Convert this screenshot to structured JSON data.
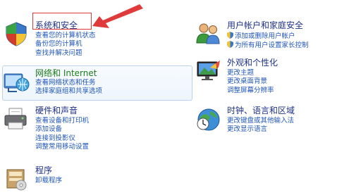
{
  "categories": {
    "system_security": {
      "title": "系统和安全",
      "links": [
        "查看您的计算机状态",
        "备份您的计算机",
        "查找并解决问题"
      ]
    },
    "network": {
      "title": "网络和 Internet",
      "links": [
        "查看网络状态和任务",
        "选择家庭组和共享选项"
      ]
    },
    "hardware_sound": {
      "title": "硬件和声音",
      "links": [
        "查看设备和打印机",
        "添加设备",
        "连接到投影仪",
        "调整常用移动设置"
      ]
    },
    "programs": {
      "title": "程序",
      "links": [
        "卸载程序"
      ]
    },
    "user_accounts": {
      "title": "用户帐户和家庭安全",
      "links": [
        "添加或删除用户帐户",
        "为所有用户设置家长控制"
      ]
    },
    "appearance": {
      "title": "外观和个性化",
      "links": [
        "更改主题",
        "更改桌面背景",
        "调整屏幕分辨率"
      ]
    },
    "clock_region": {
      "title": "时钟、语言和区域",
      "links": [
        "更改键盘或其他输入法",
        "更改显示语言"
      ]
    }
  },
  "colors": {
    "title": "#1e3287",
    "link": "#1f56b8",
    "annotation": "#e03b3b"
  }
}
